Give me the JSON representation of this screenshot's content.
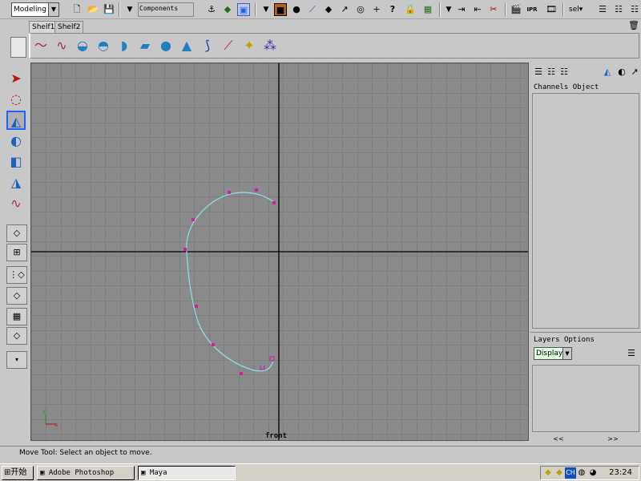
{
  "toolbar": {
    "mode": "Modeling",
    "components_label": "Components",
    "selection_label": "sel",
    "accent_color": "#2060ff"
  },
  "shelf": {
    "tabs": [
      "Shelf1",
      "Shelf2"
    ],
    "icons": [
      "cv-curve-icon",
      "ep-curve-icon",
      "revolve-icon",
      "loft-icon",
      "extrude-icon",
      "planar-icon",
      "sphere-icon",
      "cone-icon",
      "joint-icon",
      "ik-handle-icon",
      "light-icon",
      "particle-icon"
    ]
  },
  "viewport": {
    "camera_label": "front",
    "curve_color": "#8ae0e8",
    "cv_color": "#d020a0",
    "axis_indicator": {
      "x": "x",
      "y": "y"
    }
  },
  "channel_box": {
    "header_1": "Channels",
    "header_2": "Object"
  },
  "layer_box": {
    "header_1": "Layers",
    "header_2": "Options",
    "display_label": "Display",
    "scroll_left": "<<",
    "scroll_right": ">>"
  },
  "help_line": {
    "text": "Move Tool: Select an object to move."
  },
  "taskbar": {
    "start_label": "开始",
    "tasks": [
      "Adobe Photoshop",
      "Maya"
    ],
    "active_task": "Maya",
    "ime_label": "CH",
    "clock": "23:24"
  }
}
